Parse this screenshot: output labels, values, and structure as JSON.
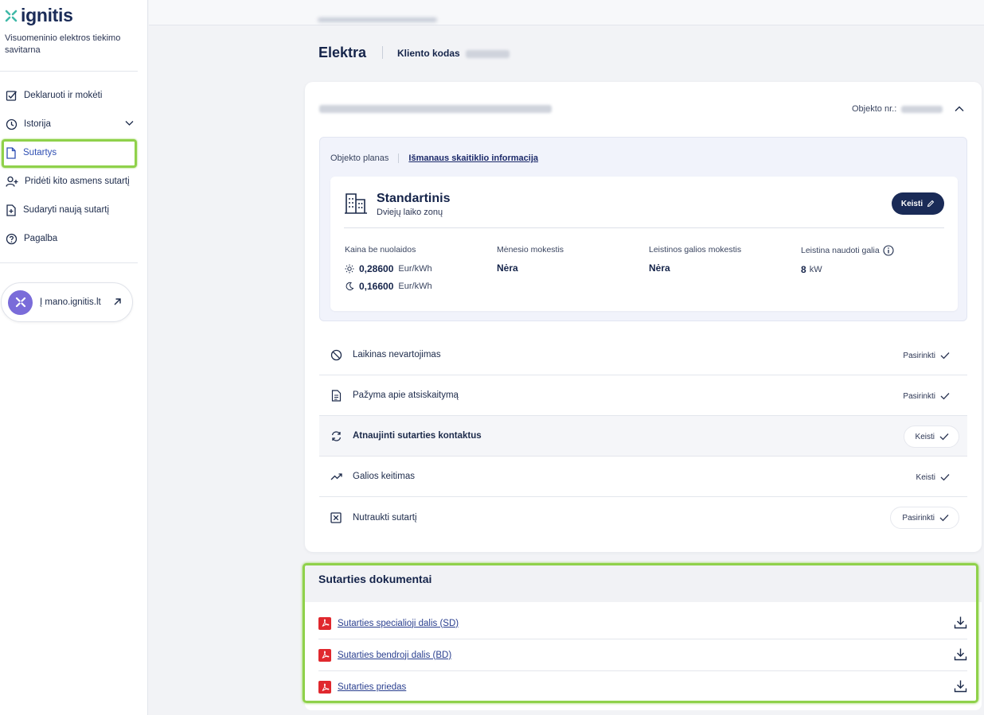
{
  "brand": {
    "name": "ignitis",
    "tagline": "Visuomeninio elektros tiekimo savitarna",
    "accent": "#1a2b57",
    "highlight": "#8fd14a"
  },
  "sidebar": {
    "items": [
      {
        "label": "Deklaruoti ir mokėti",
        "icon": "checkbox-edit-icon"
      },
      {
        "label": "Istorija",
        "icon": "clock-icon"
      },
      {
        "label": "Sutartys",
        "icon": "document-icon"
      },
      {
        "label": "Pridėti kito asmens sutartį",
        "icon": "user-add-icon"
      },
      {
        "label": "Sudaryti naują sutartį",
        "icon": "document-add-icon"
      },
      {
        "label": "Pagalba",
        "icon": "help-icon"
      }
    ],
    "external_link": "Į mano.ignitis.lt"
  },
  "header": {
    "title": "Elektra",
    "client_code_label": "Kliento kodas"
  },
  "object": {
    "nr_label": "Objekto nr.:",
    "tabs": [
      "Objekto planas",
      "Išmanaus skaitiklio informacija"
    ],
    "plan": {
      "name": "Standartinis",
      "subtitle": "Dviejų laiko zonų",
      "change_button": "Keisti",
      "price_label": "Kaina be nuolaidos",
      "day_price": "0,28600",
      "night_price": "0,16600",
      "price_unit": "Eur/kWh",
      "monthly_fee_label": "Mėnesio mokestis",
      "monthly_fee_value": "Nėra",
      "power_fee_label": "Leistinos galios mokestis",
      "power_fee_value": "Nėra",
      "allowed_power_label": "Leistina naudoti galia",
      "allowed_power_value": "8",
      "allowed_power_unit": "kW"
    },
    "actions": [
      {
        "label": "Laikinas nevartojimas",
        "button": "Pasirinkti",
        "icon": "block-icon"
      },
      {
        "label": "Pažyma apie atsiskaitymą",
        "button": "Pasirinkti",
        "icon": "file-text-icon"
      },
      {
        "label": "Atnaujinti sutarties kontaktus",
        "button": "Keisti",
        "icon": "refresh-icon"
      },
      {
        "label": "Galios keitimas",
        "button": "Keisti",
        "icon": "trend-up-icon"
      },
      {
        "label": "Nutraukti sutartį",
        "button": "Pasirinkti",
        "icon": "close-box-icon"
      }
    ]
  },
  "documents": {
    "title": "Sutarties dokumentai",
    "items": [
      {
        "label": "Sutarties specialioji dalis (SD)"
      },
      {
        "label": "Sutarties bendroji dalis (BD)"
      },
      {
        "label": "Sutarties priedas"
      }
    ]
  }
}
